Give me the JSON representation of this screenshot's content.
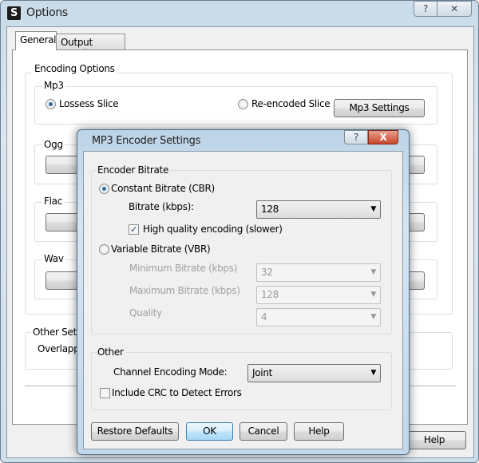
{
  "options_window": {
    "title": "Options",
    "help_glyph": "?",
    "close_glyph": "✕",
    "tabs": [
      {
        "label": "General"
      },
      {
        "label": "Output Details"
      }
    ],
    "encoding_options": {
      "label": "Encoding Options",
      "mp3": {
        "label": "Mp3",
        "lossless": "Lossess Slice",
        "reencoded": "Re-encoded Slice",
        "settings_button": "Mp3 Settings"
      },
      "ogg": {
        "label": "Ogg"
      },
      "flac": {
        "label": "Flac"
      },
      "wav": {
        "label": "Wav"
      }
    },
    "other_settings": {
      "label": "Other Setting",
      "overlapping": "Overlapping"
    },
    "help_button": "Help"
  },
  "dialog": {
    "title": "MP3 Encoder Settings",
    "help_glyph": "?",
    "close_glyph": "X",
    "encoder_bitrate": {
      "label": "Encoder Bitrate",
      "cbr": "Constant Bitrate (CBR)",
      "bitrate_label": "Bitrate (kbps):",
      "bitrate_value": "128",
      "high_quality": "High quality encoding (slower)",
      "high_quality_checked": true,
      "vbr": "Variable Bitrate (VBR)",
      "min_label": "Minimum Bitrate (kbps)",
      "min_value": "32",
      "max_label": "Maximum Bitrate (kbps)",
      "max_value": "128",
      "quality_label": "Quality",
      "quality_value": "4"
    },
    "other": {
      "label": "Other",
      "channel_label": "Channel Encoding Mode:",
      "channel_value": "Joint",
      "crc": "Include CRC to Detect Errors",
      "crc_checked": false
    },
    "buttons": {
      "restore": "Restore Defaults",
      "ok": "OK",
      "cancel": "Cancel",
      "help": "Help"
    }
  }
}
